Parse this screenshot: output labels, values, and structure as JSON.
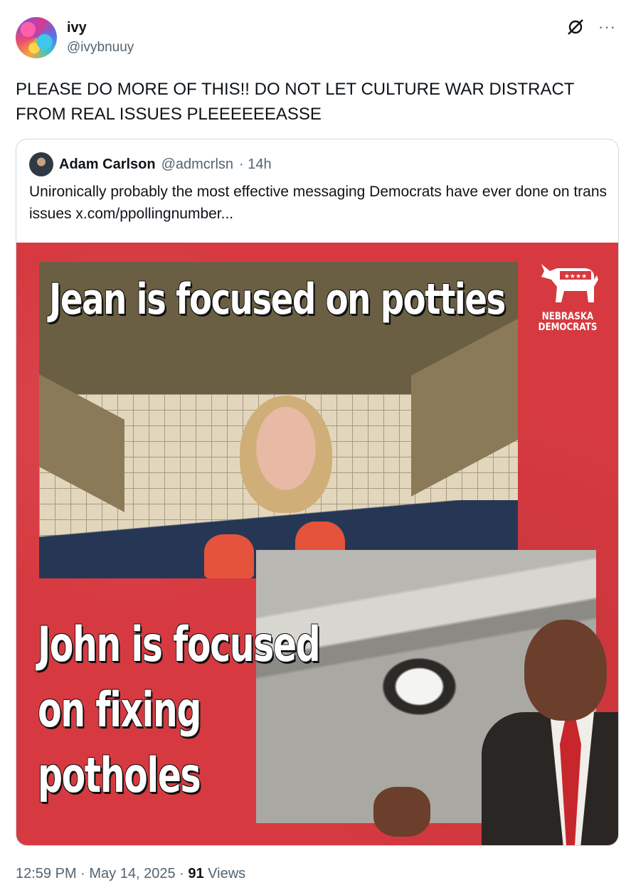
{
  "author": {
    "name": "ivy",
    "handle": "@ivybnuuy"
  },
  "tweet_text": "PLEASE DO MORE OF THIS!! DO NOT LET CULTURE WAR DISTRACT FROM REAL ISSUES PLEEEEEEASSE",
  "quoted": {
    "name": "Adam Carlson",
    "handle": "@admcrlsn",
    "time": "· 14h",
    "text": "Unironically probably the most effective messaging Democrats have ever done on trans issues  x.com/ppollingnumber..."
  },
  "ad_image": {
    "headline_top": "Jean is focused on potties",
    "headline_bottom_1": "John is focused",
    "headline_bottom_2": "on fixing",
    "headline_bottom_3": "potholes",
    "logo_line1": "NEBRASKA",
    "logo_line2": "DEMOCRATS"
  },
  "footer": {
    "time": "12:59 PM",
    "sep1": " · ",
    "date": "May 14, 2025",
    "sep2": " · ",
    "views_count": "91",
    "views_label": " Views"
  },
  "colors": {
    "ad_red": "#d63a40",
    "secondary_text": "#536471"
  },
  "icons": [
    "grok-icon",
    "more-icon"
  ]
}
